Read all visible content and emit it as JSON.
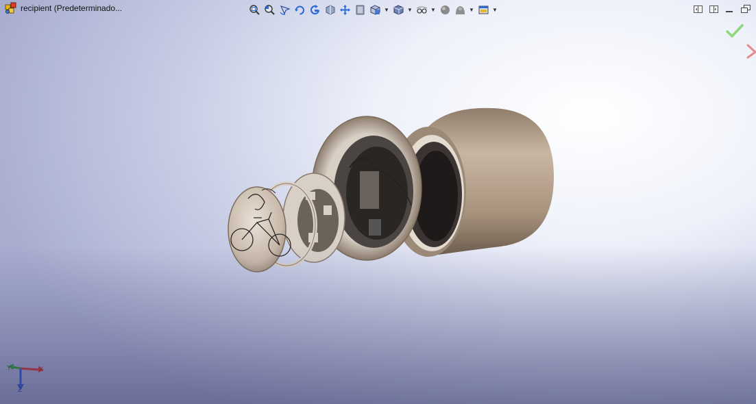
{
  "window": {
    "title": "recipient  (Predeterminado..."
  },
  "toolbar": {
    "items": [
      {
        "icon": "zoom-to-fit-icon"
      },
      {
        "icon": "zoom-to-area-icon"
      },
      {
        "icon": "previous-view-icon"
      },
      {
        "icon": "rotate-view-icon"
      },
      {
        "icon": "rotate-about-icon"
      },
      {
        "icon": "section-view-icon"
      },
      {
        "icon": "pan-icon"
      },
      {
        "icon": "3d-drawing-view-icon"
      },
      {
        "icon": "view-orientation-icon"
      },
      {
        "icon": "display-style-icon"
      },
      {
        "icon": "hide-show-items-icon"
      },
      {
        "icon": "edit-appearance-icon"
      },
      {
        "icon": "apply-scene-icon"
      },
      {
        "icon": "view-settings-icon"
      }
    ]
  },
  "colors": {
    "accept": "#5fbf3f",
    "cancel": "#d44a4a",
    "model_metal": "#b9a896",
    "background_top": "#ffffff",
    "background_bottom": "#a8add0"
  },
  "triad": {
    "x_label": "X",
    "y_label": "Y",
    "z_label": "Z"
  }
}
